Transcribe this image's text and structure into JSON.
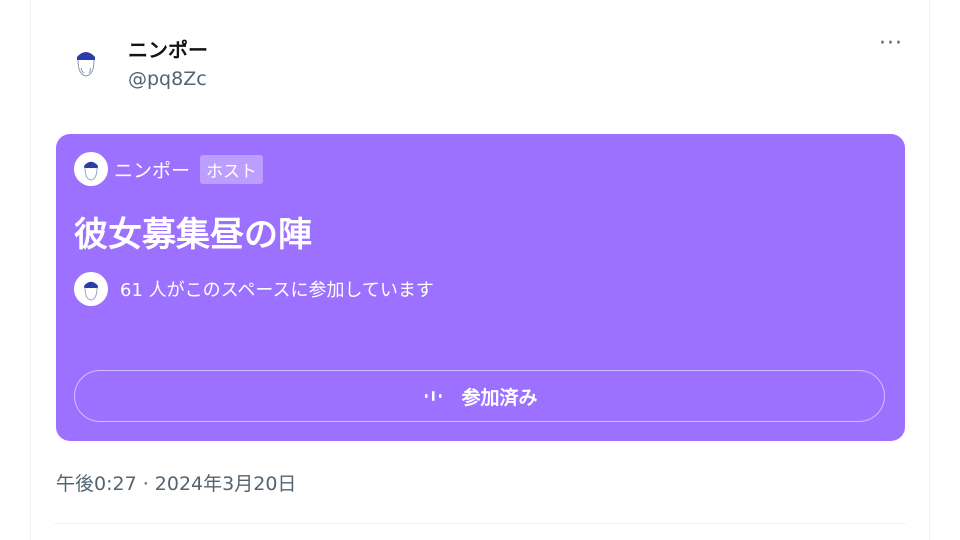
{
  "post": {
    "author": {
      "name": "ニンポー",
      "handle": "@pq8Zc",
      "more_label": "···"
    },
    "space": {
      "host_name": "ニンポー",
      "host_badge": "ホスト",
      "title": "彼女募集昼の陣",
      "listeners_text": "61 人がこのスペースに参加しています",
      "button_label": "参加済み",
      "card_color": "#9c71ff"
    },
    "timestamp": "午後0:27 · 2024年3月20日"
  }
}
